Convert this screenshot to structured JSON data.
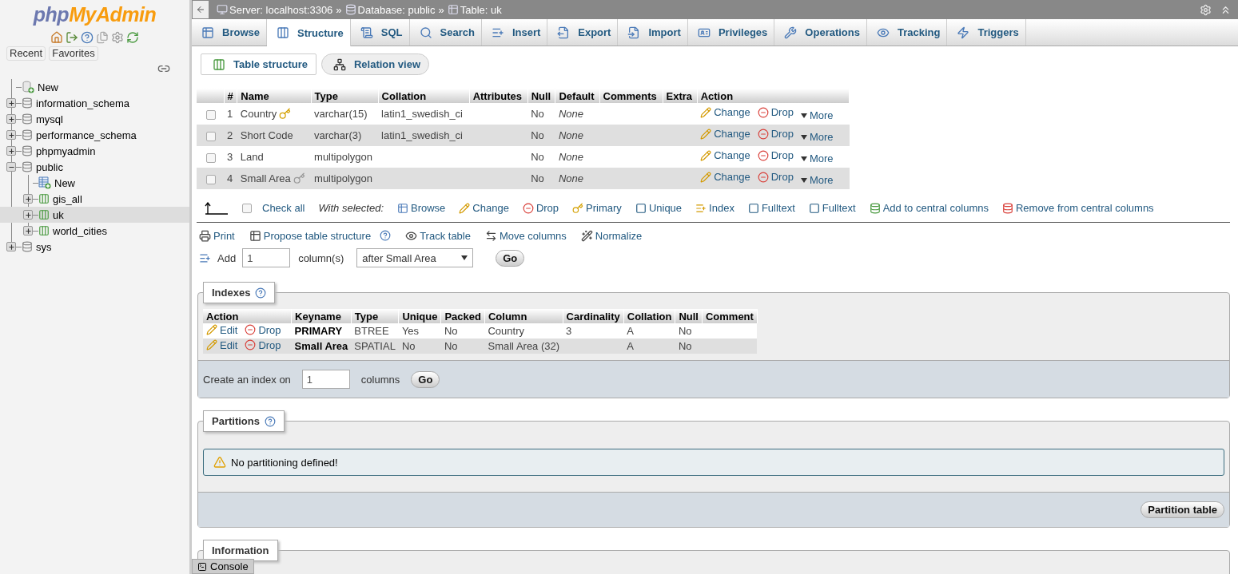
{
  "navigation": {
    "logo": {
      "first": "php",
      "second": "MyAdmin"
    },
    "lists": [
      "Recent",
      "Favorites"
    ],
    "tree": [
      {
        "label": "New",
        "kind": "new",
        "selected": false
      },
      {
        "label": "information_schema",
        "kind": "database",
        "expanded": false,
        "selected": false
      },
      {
        "label": "mysql",
        "kind": "database",
        "expanded": false,
        "selected": false
      },
      {
        "label": "performance_schema",
        "kind": "database",
        "expanded": false,
        "selected": false
      },
      {
        "label": "phpmyadmin",
        "kind": "database",
        "expanded": false,
        "selected": false
      },
      {
        "label": "public",
        "kind": "database",
        "expanded": true,
        "selected": false,
        "children": [
          {
            "label": "New",
            "kind": "new_table",
            "selected": false
          },
          {
            "label": "gis_all",
            "kind": "table",
            "expanded": false,
            "selected": false
          },
          {
            "label": "uk",
            "kind": "table",
            "expanded": false,
            "selected": true
          },
          {
            "label": "world_cities",
            "kind": "table",
            "expanded": false,
            "selected": false
          }
        ]
      },
      {
        "label": "sys",
        "kind": "database",
        "expanded": false,
        "selected": false
      }
    ]
  },
  "breadcrumb": {
    "separator": "»",
    "items": [
      {
        "label": "Server: localhost:3306",
        "kind": "server"
      },
      {
        "label": "Database: public",
        "kind": "database"
      },
      {
        "label": "Table: uk",
        "kind": "table"
      }
    ]
  },
  "tabs": [
    {
      "label": "Browse",
      "kind": "browse",
      "selected": false
    },
    {
      "label": "Structure",
      "kind": "structure",
      "selected": true
    },
    {
      "label": "SQL",
      "kind": "sql",
      "selected": false
    },
    {
      "label": "Search",
      "kind": "search",
      "selected": false
    },
    {
      "label": "Insert",
      "kind": "insert",
      "selected": false
    },
    {
      "label": "Export",
      "kind": "export",
      "selected": false
    },
    {
      "label": "Import",
      "kind": "import",
      "selected": false
    },
    {
      "label": "Privileges",
      "kind": "privileges",
      "selected": false
    },
    {
      "label": "Operations",
      "kind": "operations",
      "selected": false
    },
    {
      "label": "Tracking",
      "kind": "tracking",
      "selected": false
    },
    {
      "label": "Triggers",
      "kind": "triggers",
      "selected": false
    }
  ],
  "sub_tabs": [
    {
      "label": "Table structure",
      "kind": "structure",
      "selected": true
    },
    {
      "label": "Relation view",
      "kind": "relation",
      "selected": false
    }
  ],
  "columns_table": {
    "columns": [
      "#",
      "Name",
      "Type",
      "Collation",
      "Attributes",
      "Null",
      "Default",
      "Comments",
      "Extra",
      "Action"
    ],
    "rows": [
      {
        "checked": false,
        "number": "1",
        "name": "Country",
        "kind": "primary",
        "type": "varchar(15)",
        "collation": "latin1_swedish_ci",
        "null": "No",
        "default": "None",
        "actions": [
          "Change",
          "Drop",
          "More"
        ]
      },
      {
        "checked": false,
        "number": "2",
        "name": "Short Code",
        "kind": "plain",
        "type": "varchar(3)",
        "collation": "latin1_swedish_ci",
        "null": "No",
        "default": "None",
        "actions": [
          "Change",
          "Drop",
          "More"
        ]
      },
      {
        "checked": false,
        "number": "3",
        "name": "Land",
        "kind": "plain",
        "type": "multipolygon",
        "null": "No",
        "default": "None",
        "actions": [
          "Change",
          "Drop",
          "More"
        ]
      },
      {
        "checked": false,
        "number": "4",
        "name": "Small Area",
        "kind": "spatial",
        "type": "multipolygon",
        "null": "No",
        "default": "None",
        "actions": [
          "Change",
          "Drop",
          "More"
        ]
      }
    ]
  },
  "bulk": {
    "check_all": {
      "label": "Check all",
      "checked": false
    },
    "with_selected": "With selected:",
    "actions": [
      {
        "label": "Browse",
        "kind": "browse"
      },
      {
        "label": "Change",
        "kind": "change"
      },
      {
        "label": "Drop",
        "kind": "drop"
      },
      {
        "label": "Primary",
        "kind": "primary"
      },
      {
        "label": "Unique",
        "kind": "unique"
      },
      {
        "label": "Index",
        "kind": "index"
      },
      {
        "label": "Fulltext",
        "kind": "fulltext"
      },
      {
        "label": "Fulltext",
        "kind": "fulltext"
      },
      {
        "label": "Add to central columns",
        "kind": "add_central"
      },
      {
        "label": "Remove from central columns",
        "kind": "remove_central"
      }
    ]
  },
  "tools": [
    {
      "label": "Print",
      "kind": "print"
    },
    {
      "label": "Propose table structure",
      "kind": "propose",
      "help": true
    },
    {
      "label": "Track table",
      "kind": "track"
    },
    {
      "label": "Move columns",
      "kind": "move"
    },
    {
      "label": "Normalize",
      "kind": "normalize"
    }
  ],
  "add_columns": {
    "label": "Add",
    "value": "1",
    "unit": "column(s)",
    "position": "after Small Area",
    "button": "Go"
  },
  "indexes": {
    "legend": "Indexes",
    "columns": [
      "Action",
      "Keyname",
      "Type",
      "Unique",
      "Packed",
      "Column",
      "Cardinality",
      "Collation",
      "Null",
      "Comment"
    ],
    "rows": [
      {
        "actions": [
          "Edit",
          "Drop"
        ],
        "keyname": "PRIMARY",
        "type": "BTREE",
        "unique": "Yes",
        "packed": "No",
        "column": "Country",
        "cardinality": "3",
        "collation": "A",
        "null": "No"
      },
      {
        "actions": [
          "Edit",
          "Drop"
        ],
        "keyname": "Small Area",
        "type": "SPATIAL",
        "unique": "No",
        "packed": "No",
        "column": "Small Area (32)",
        "collation": "A",
        "null": "No"
      }
    ],
    "create": {
      "label": "Create an index on",
      "value": "1",
      "unit": "columns",
      "button": "Go"
    }
  },
  "partitions": {
    "legend": "Partitions",
    "notice": "No partitioning defined!",
    "button": "Partition table"
  },
  "information": {
    "legend": "Information"
  },
  "console": "Console"
}
